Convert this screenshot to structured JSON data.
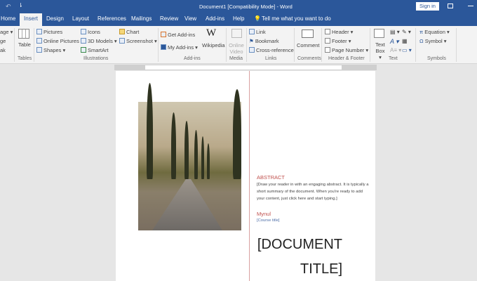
{
  "title_bar": {
    "title": "Document1 [Compatibility Mode]  -  Word",
    "sign_in": "Sign in",
    "undo": "↶",
    "customize": "⇂"
  },
  "tabs": [
    "Home",
    "Insert",
    "Design",
    "Layout",
    "References",
    "Mailings",
    "Review",
    "View",
    "Add-ins",
    "Help"
  ],
  "tell_me": "Tell me what you want to do",
  "ribbon": {
    "pages": [
      "age ▾",
      "ge",
      "ak"
    ],
    "table": "Table",
    "tables_group": "Tables",
    "pictures": "Pictures",
    "online_pictures": "Online Pictures",
    "shapes": "Shapes ▾",
    "icons": "Icons",
    "models_3d": "3D Models ▾",
    "smartart": "SmartArt",
    "chart": "Chart",
    "screenshot": "Screenshot ▾",
    "illustrations_group": "Illustrations",
    "get_addins": "Get Add-ins",
    "my_addins": "My Add-ins ▾",
    "wikipedia": "Wikipedia",
    "addins_group": "Add-ins",
    "online_video": "Online Video",
    "media_group": "Media",
    "link": "Link",
    "bookmark": "Bookmark",
    "cross_reference": "Cross-reference",
    "links_group": "Links",
    "comment": "Comment",
    "comments_group": "Comments",
    "header": "Header ▾",
    "footer": "Footer ▾",
    "page_number": "Page Number ▾",
    "header_footer_group": "Header & Footer",
    "text_box": "Text Box ▾",
    "text_group": "Text",
    "equation": "Equation ▾",
    "symbol": "Symbol ▾",
    "symbols_group": "Symbols"
  },
  "document": {
    "title_line1": "[DOCUMENT",
    "title_line2": "TITLE]",
    "abstract_heading": "ABSTRACT",
    "abstract_body": "[Draw your reader in with an engaging abstract. It is typically a short summary of the document. When you're ready to add your content, just click here and start typing.]",
    "author": "Mynul",
    "course": "[Course title]"
  },
  "colors": {
    "brand": "#2b579a",
    "accent": "#c0504d"
  }
}
